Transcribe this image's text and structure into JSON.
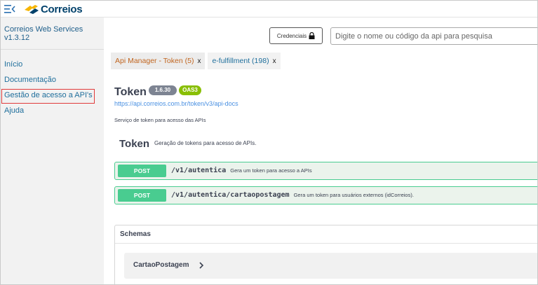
{
  "header": {
    "logo_text": "Correios",
    "menu_icon": "menu-collapse-icon"
  },
  "sidebar": {
    "title": "Correios Web Services",
    "version": "v1.3.12",
    "items": [
      {
        "label": "Início"
      },
      {
        "label": "Documentação"
      },
      {
        "label": "Gestão de acesso a API's"
      },
      {
        "label": "Ajuda"
      }
    ]
  },
  "toolbar": {
    "credentials_label": "Credenciais",
    "search_placeholder": "Digite o nome ou código da api para pesquisa"
  },
  "tabs": [
    {
      "label": "Api Manager - Token (5)",
      "close": "x"
    },
    {
      "label": "e-fulfillment (198)",
      "close": "x"
    }
  ],
  "api": {
    "title": "Token",
    "version_badge": "1.6.30",
    "oas_badge": "OAS3",
    "url": "https://api.correios.com.br/token/v3/api-docs",
    "description": "Serviço de token para acesso das APIs"
  },
  "section": {
    "title": "Token",
    "description": "Geração de tokens para acesso de APIs."
  },
  "operations": [
    {
      "method": "POST",
      "path": "/v1/autentica",
      "summary": "Gera um token para acesso a APIs"
    },
    {
      "method": "POST",
      "path": "/v1/autentica/cartaopostagem",
      "summary": "Gera um token para usuários externos (idCorreios)."
    }
  ],
  "schemas": {
    "title": "Schemas",
    "models": [
      {
        "name": "CartaoPostagem"
      }
    ]
  },
  "colors": {
    "brand_blue": "#00416b",
    "brand_yellow": "#f7b500",
    "post_green": "#49cc90",
    "active_tab_text": "#c1651f",
    "highlight_red": "#e03a3a"
  }
}
